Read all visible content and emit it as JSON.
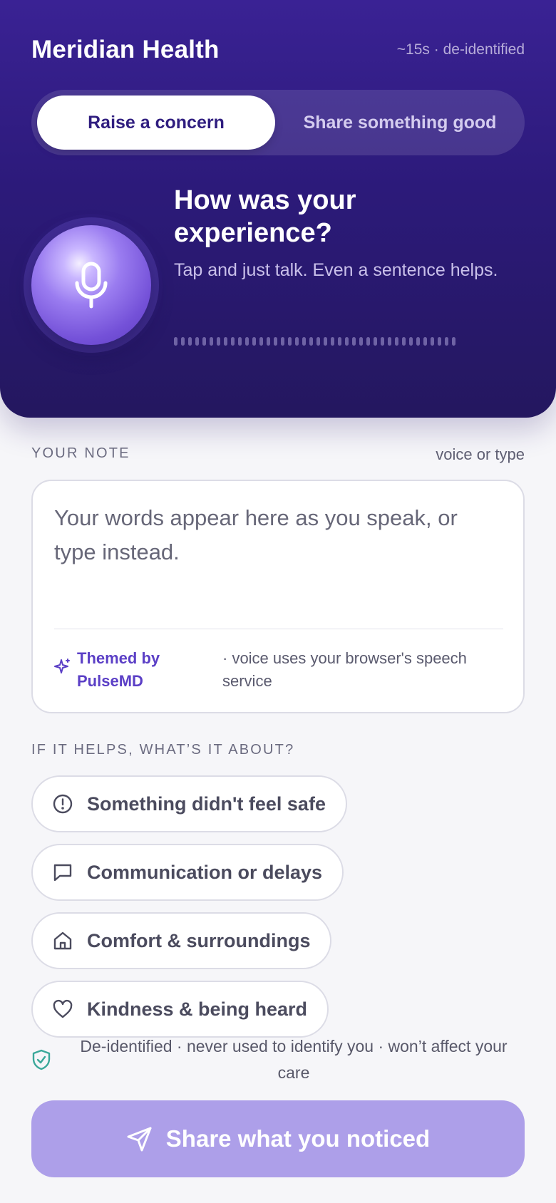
{
  "header": {
    "brand": "Meridian Health",
    "meta": "~15s · de-identified"
  },
  "mode_toggle": {
    "options": [
      {
        "label": "Raise a concern",
        "selected": true
      },
      {
        "label": "Share something good",
        "selected": false
      }
    ]
  },
  "prompt": {
    "title": "How was your experience?",
    "subtitle": "Tap and just talk. Even a sentence helps.",
    "mic_icon": "microphone-icon"
  },
  "note": {
    "section_label": "YOUR NOTE",
    "hint": "voice or type",
    "placeholder": "Your words appear here as you speak, or type instead.",
    "value": "",
    "theme_credit": "Themed by PulseMD",
    "voice_disclaimer": "· voice uses your browser's speech service"
  },
  "categories": {
    "section_label": "IF IT HELPS, WHAT’S IT ABOUT?",
    "items": [
      {
        "label": "Something didn't feel safe",
        "icon": "alert-circle-icon"
      },
      {
        "label": "Communication or delays",
        "icon": "message-square-icon"
      },
      {
        "label": "Comfort & surroundings",
        "icon": "home-icon"
      },
      {
        "label": "Kindness & being heard",
        "icon": "heart-icon"
      }
    ]
  },
  "footer": {
    "privacy_note": "De-identified · never used to identify you · won’t affect your care",
    "submit_label": "Share what you noticed"
  },
  "colors": {
    "hero": "#2c1a7a",
    "accent": "#5b3fc6",
    "submit_disabled": "#ad9fe9",
    "shield": "#3aa89a"
  }
}
